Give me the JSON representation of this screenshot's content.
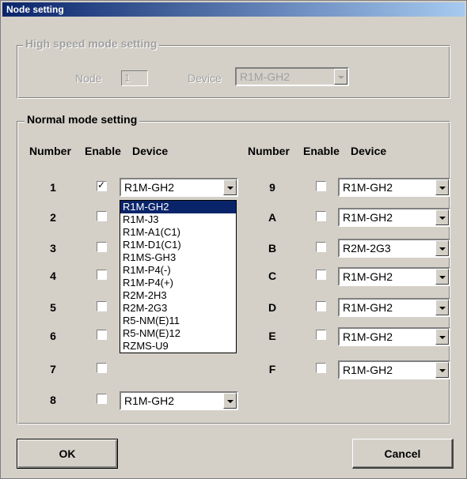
{
  "window": {
    "title": "Node setting"
  },
  "high_speed": {
    "legend": "High speed mode setting",
    "node_label": "Node",
    "node_value": "1",
    "device_label": "Device",
    "device_value": "R1M-GH2"
  },
  "normal": {
    "legend": "Normal mode setting",
    "headers": {
      "number": "Number",
      "enable": "Enable",
      "device": "Device"
    },
    "left_rows": [
      {
        "number": "1",
        "checked": true,
        "device": "R1M-GH2"
      },
      {
        "number": "2",
        "checked": false,
        "device": ""
      },
      {
        "number": "3",
        "checked": false,
        "device": ""
      },
      {
        "number": "4",
        "checked": false,
        "device": ""
      },
      {
        "number": "5",
        "checked": false,
        "device": ""
      },
      {
        "number": "6",
        "checked": false,
        "device": ""
      },
      {
        "number": "7",
        "checked": false,
        "device": ""
      },
      {
        "number": "8",
        "checked": false,
        "device": "R1M-GH2"
      }
    ],
    "right_rows": [
      {
        "number": "9",
        "checked": false,
        "device": "R1M-GH2"
      },
      {
        "number": "A",
        "checked": false,
        "device": "R1M-GH2"
      },
      {
        "number": "B",
        "checked": false,
        "device": "R2M-2G3"
      },
      {
        "number": "C",
        "checked": false,
        "device": "R1M-GH2"
      },
      {
        "number": "D",
        "checked": false,
        "device": "R1M-GH2"
      },
      {
        "number": "E",
        "checked": false,
        "device": "R1M-GH2"
      },
      {
        "number": "F",
        "checked": false,
        "device": "R1M-GH2"
      }
    ],
    "dropdown_options": [
      "R1M-GH2",
      "R1M-J3",
      "R1M-A1(C1)",
      "R1M-D1(C1)",
      "R1MS-GH3",
      "R1M-P4(-)",
      "R1M-P4(+)",
      "R2M-2H3",
      "R2M-2G3",
      "R5-NM(E)11",
      "R5-NM(E)12",
      "RZMS-U9"
    ],
    "dropdown_selected_index": 0
  },
  "buttons": {
    "ok": "OK",
    "cancel": "Cancel"
  },
  "colors": {
    "dialog_bg": "#d4d0c8",
    "title_start": "#0a246a",
    "title_end": "#a6caf0",
    "selection": "#0a246a"
  }
}
